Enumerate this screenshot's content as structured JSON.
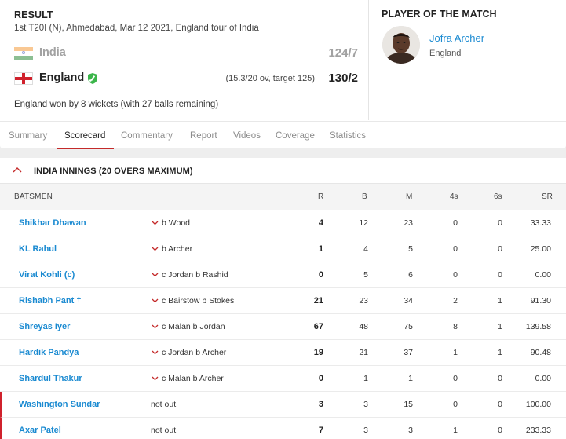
{
  "header": {
    "result_label": "RESULT",
    "match_desc": "1st T20I (N), Ahmedabad, Mar 12 2021, England tour of India",
    "teams": [
      {
        "name": "India",
        "extra": "",
        "score": "124/7",
        "flag": "india-flag-icon"
      },
      {
        "name": "England",
        "extra": "(15.3/20 ov, target 125)",
        "score": "130/2",
        "flag": "england-flag-icon",
        "batting_icon": "bat-shield-icon"
      }
    ],
    "result_text": "England won by 8 wickets (with 27 balls remaining)"
  },
  "potm": {
    "label": "PLAYER OF THE MATCH",
    "name": "Jofra Archer",
    "team": "England"
  },
  "tabs": [
    {
      "label": "Summary",
      "active": false
    },
    {
      "label": "Scorecard",
      "active": true
    },
    {
      "label": "Commentary",
      "active": false
    },
    {
      "label": "Report",
      "active": false
    },
    {
      "label": "Videos",
      "active": false
    },
    {
      "label": "Coverage",
      "active": false
    },
    {
      "label": "Statistics",
      "active": false
    }
  ],
  "innings": {
    "title": "INDIA INNINGS (20 OVERS MAXIMUM)",
    "columns": {
      "batsmen": "BATSMEN",
      "r": "R",
      "b": "B",
      "m": "M",
      "fours": "4s",
      "sixes": "6s",
      "sr": "SR"
    },
    "rows": [
      {
        "name": "Shikhar Dhawan",
        "dismissal": "b Wood",
        "r": "4",
        "b": "12",
        "m": "23",
        "fours": "0",
        "sixes": "0",
        "sr": "33.33",
        "not_out": false
      },
      {
        "name": "KL Rahul",
        "dismissal": "b Archer",
        "r": "1",
        "b": "4",
        "m": "5",
        "fours": "0",
        "sixes": "0",
        "sr": "25.00",
        "not_out": false
      },
      {
        "name": "Virat Kohli (c)",
        "dismissal": "c Jordan b Rashid",
        "r": "0",
        "b": "5",
        "m": "6",
        "fours": "0",
        "sixes": "0",
        "sr": "0.00",
        "not_out": false
      },
      {
        "name": "Rishabh Pant †",
        "dismissal": "c Bairstow b Stokes",
        "r": "21",
        "b": "23",
        "m": "34",
        "fours": "2",
        "sixes": "1",
        "sr": "91.30",
        "not_out": false
      },
      {
        "name": "Shreyas Iyer",
        "dismissal": "c Malan b Jordan",
        "r": "67",
        "b": "48",
        "m": "75",
        "fours": "8",
        "sixes": "1",
        "sr": "139.58",
        "not_out": false
      },
      {
        "name": "Hardik Pandya",
        "dismissal": "c Jordan b Archer",
        "r": "19",
        "b": "21",
        "m": "37",
        "fours": "1",
        "sixes": "1",
        "sr": "90.48",
        "not_out": false
      },
      {
        "name": "Shardul Thakur",
        "dismissal": "c Malan b Archer",
        "r": "0",
        "b": "1",
        "m": "1",
        "fours": "0",
        "sixes": "0",
        "sr": "0.00",
        "not_out": false
      },
      {
        "name": "Washington Sundar",
        "dismissal": "not out",
        "r": "3",
        "b": "3",
        "m": "15",
        "fours": "0",
        "sixes": "0",
        "sr": "100.00",
        "not_out": true
      },
      {
        "name": "Axar Patel",
        "dismissal": "not out",
        "r": "7",
        "b": "3",
        "m": "3",
        "fours": "1",
        "sixes": "0",
        "sr": "233.33",
        "not_out": true
      }
    ]
  },
  "colors": {
    "link_blue": "#1a8ad1",
    "accent_red": "#c42a2a",
    "not_out_bar": "#d0212c",
    "faded_text": "#a2a2a2"
  }
}
